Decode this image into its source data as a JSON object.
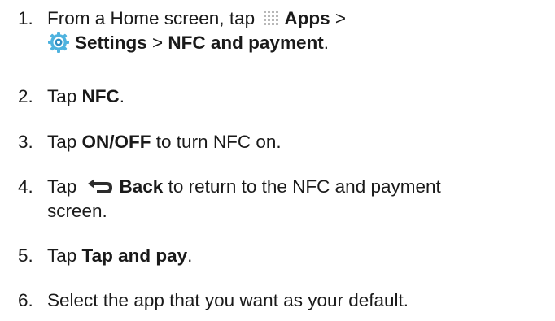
{
  "steps": [
    {
      "number": "1.",
      "line1": {
        "pre": "From a Home screen, tap ",
        "apps_icon": "apps-grid-icon",
        "apps_label": "Apps",
        "sep": " >"
      },
      "line2": {
        "settings_icon": "settings-gear-icon",
        "settings_label": "Settings",
        "sep": " > ",
        "nfc_payment_label": "NFC and payment",
        "end": "."
      }
    },
    {
      "number": "2.",
      "pre": "Tap ",
      "bold": "NFC",
      "post": "."
    },
    {
      "number": "3.",
      "pre": "Tap ",
      "bold": "ON/OFF",
      "post": " to turn NFC on."
    },
    {
      "number": "4.",
      "pre": "Tap ",
      "back_icon": "back-arrow-icon",
      "bold": "Back",
      "post": " to return to the NFC and payment",
      "line2": "screen."
    },
    {
      "number": "5.",
      "pre": "Tap ",
      "bold": "Tap and pay",
      "post": "."
    },
    {
      "number": "6.",
      "text": "Select the app that you want as your default."
    }
  ],
  "colors": {
    "text": "#1a1a1a",
    "apps_icon": "#b8b8b8",
    "settings_icon_outer": "#4fb3df",
    "settings_icon_inner": "#2f8fc4",
    "back_icon": "#2c2c2c"
  }
}
